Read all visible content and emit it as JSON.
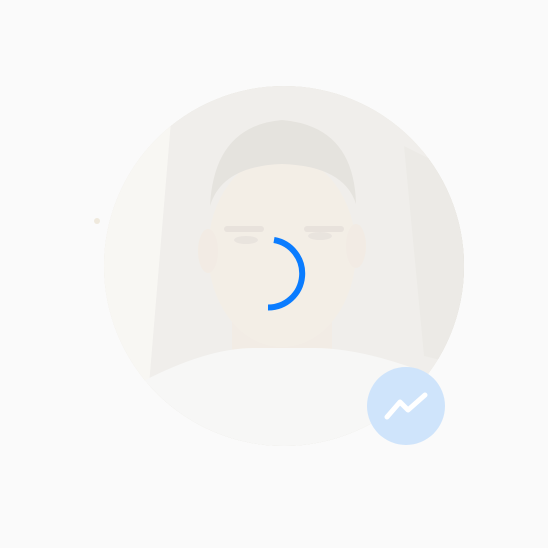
{
  "profile": {
    "avatar_icon": "person-photo",
    "loading_state": "loading",
    "badge_icon": "messenger-bolt-icon"
  },
  "colors": {
    "background": "#fafafa",
    "spinner": "#0a7cff",
    "badge_background": "#cfe4fb",
    "badge_glyph": "#ffffff"
  }
}
